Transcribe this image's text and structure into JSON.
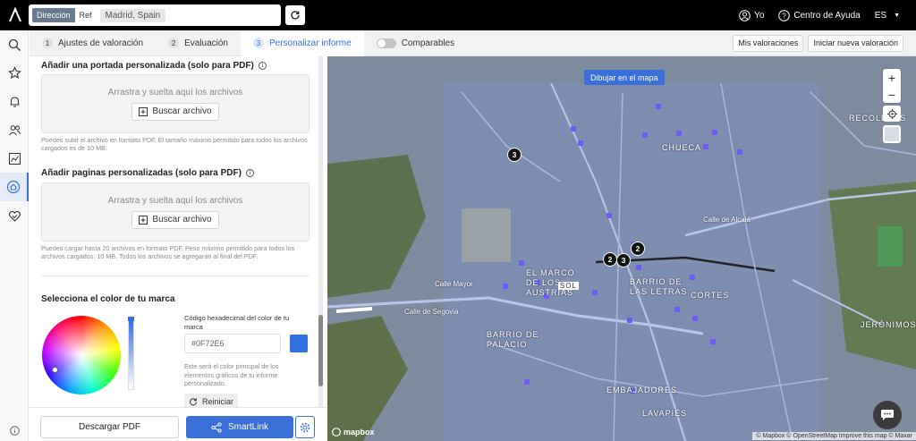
{
  "header": {
    "search_modes": [
      "Dirección",
      "Ref"
    ],
    "address": "Madrid, Spain",
    "user_label": "Yo",
    "help_label": "Centro de Ayuda",
    "lang": "ES"
  },
  "tabs": [
    {
      "num": "1",
      "label": "Ajustes de valoración"
    },
    {
      "num": "2",
      "label": "Evaluación"
    },
    {
      "num": "3",
      "label": "Personalizar informe"
    }
  ],
  "toolbar": {
    "comparables_label": "Comparables",
    "my_valuations": "Mis valoraciones",
    "new_valuation": "Iniciar nueva valoración"
  },
  "panel": {
    "cover": {
      "title": "Añadir una portada personalizada (solo para PDF)",
      "drop_text": "Arrastra y suelta aquí los archivos",
      "button": "Buscar archivo",
      "help": "Puedes subir el archivo en formato PDF. El tamaño máximo permitido para todos los archivos cargados es de 10 MB."
    },
    "pages": {
      "title": "Añadir paginas personalizadas (solo para PDF)",
      "drop_text": "Arrastra y suelta aquí los archivos",
      "button": "Buscar archivo",
      "help": "Puedes cargar hasta 20 archivos en formato PDF. Peso máximo permitido para todos los archivos cargados: 10 MB. Todos los archivos se agregarán al final del PDF."
    },
    "brand": {
      "title": "Selecciona el color de tu marca",
      "hex_label": "Código hexadecimal del color de tu marca",
      "hex_value": "#0F72E6",
      "swatch_color": "#2f6fe0",
      "help": "Este será el color principal de los elementos gráficos de tu informe personalizado.",
      "reset": "Reiniciar"
    }
  },
  "footer": {
    "download": "Descargar PDF",
    "smartlink": "SmartLink"
  },
  "map": {
    "draw_button": "Dibujar en el mapa",
    "clusters": [
      "3",
      "2",
      "2",
      "3"
    ],
    "labels": [
      "CHUECA",
      "RECOLETOS",
      "EL MARCO DE LOS AUSTRIAS",
      "BARRIO DE LAS LETRAS",
      "CORTES",
      "BARRIO DE PALACIO",
      "JERÓNIMOS",
      "EMBAJADORES",
      "LAVAPIÉS",
      "SOL",
      "Calle de Segovia",
      "Calle Mayor",
      "Calle de Alcalá"
    ],
    "logo": "mapbox",
    "attribution": "© Mapbox © OpenStreetMap Improve this map © Maxar"
  },
  "colors": {
    "accent": "#3b6fd8",
    "brand": "#0F72E6"
  }
}
